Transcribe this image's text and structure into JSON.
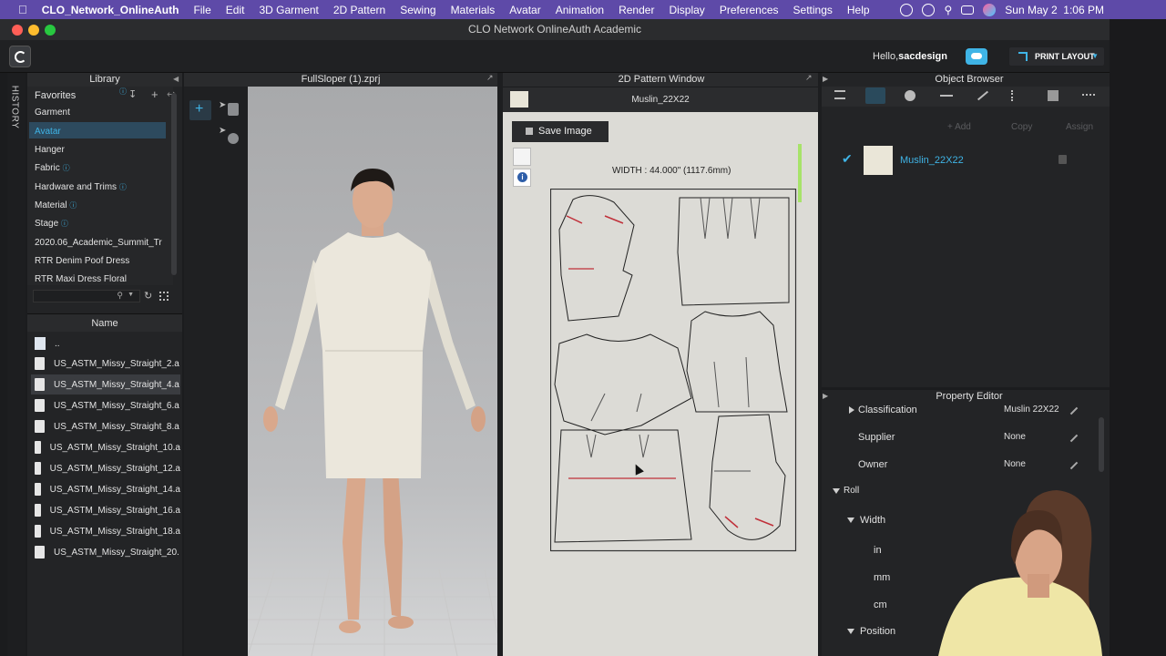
{
  "menubar": {
    "apple": "",
    "app_name": "CLO_Network_OnlineAuth",
    "items": [
      "File",
      "Edit",
      "3D Garment",
      "2D Pattern",
      "Sewing",
      "Materials",
      "Avatar",
      "Animation",
      "Render",
      "Display",
      "Preferences",
      "Settings",
      "Help"
    ],
    "clock": "Sun May 2  1:06 PM"
  },
  "window": {
    "title": "CLO Network OnlineAuth Academic"
  },
  "toolbar": {
    "greeting": "Hello,",
    "username": "sacdesign",
    "layout_label": "PRINT LAYOUT"
  },
  "history_tab": "HISTORY",
  "library": {
    "title": "Library",
    "items": [
      "Favorites",
      "Garment",
      "Avatar",
      "Hanger",
      "Fabric",
      "Hardware and Trims",
      "Material",
      "Stage",
      "2020.06_Academic_Summit_Tr",
      "RTR Denim Poof Dress",
      "RTR Maxi Dress Floral"
    ],
    "selected_index": 2,
    "name_header": "Name",
    "parent_folder": "..",
    "files": [
      "US_ASTM_Missy_Straight_2.a",
      "US_ASTM_Missy_Straight_4.a",
      "US_ASTM_Missy_Straight_6.a",
      "US_ASTM_Missy_Straight_8.a",
      "US_ASTM_Missy_Straight_10.a",
      "US_ASTM_Missy_Straight_12.a",
      "US_ASTM_Missy_Straight_14.a",
      "US_ASTM_Missy_Straight_16.a",
      "US_ASTM_Missy_Straight_18.a",
      "US_ASTM_Missy_Straight_20."
    ],
    "selected_file_index": 1
  },
  "view3d": {
    "title": "FullSloper (1).zprj"
  },
  "pattern2d": {
    "title": "2D Pattern Window",
    "fabric_name": "Muslin_22X22",
    "save_image": "Save Image",
    "width_label": "WIDTH : 44.000\" (1117.6mm)"
  },
  "object_browser": {
    "title": "Object Browser",
    "add": "Add",
    "copy": "Copy",
    "assign": "Assign",
    "fabric": "Muslin_22X22"
  },
  "property_editor": {
    "title": "Property Editor",
    "rows": [
      {
        "label": "Classification",
        "value": "Muslin 22X22"
      },
      {
        "label": "Supplier",
        "value": "None"
      },
      {
        "label": "Owner",
        "value": "None"
      }
    ],
    "roll": "Roll",
    "width": "Width",
    "units": [
      "in",
      "mm",
      "cm"
    ],
    "position": "Position"
  },
  "colors": {
    "accent": "#3fb4e6",
    "menubar": "#5e4aa8",
    "panel": "#232426",
    "pattern_bg": "#dcdbd6"
  }
}
